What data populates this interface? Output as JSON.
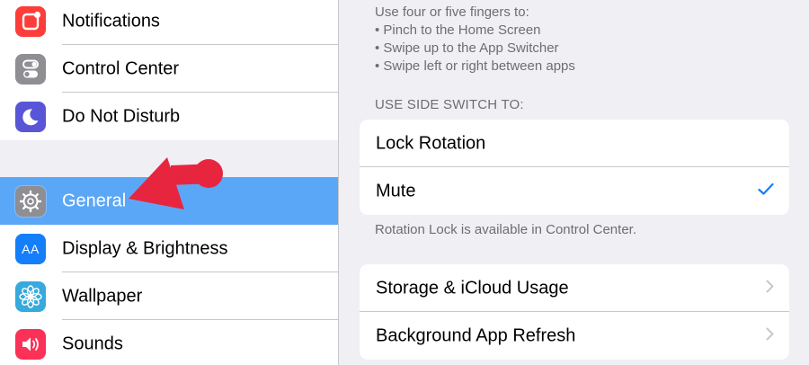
{
  "sidebar": {
    "items": [
      {
        "label": "Notifications",
        "icon": "notifications-icon",
        "icon_color": "#fc3d39"
      },
      {
        "label": "Control Center",
        "icon": "control-center-icon",
        "icon_color": "#8e8e93"
      },
      {
        "label": "Do Not Disturb",
        "icon": "moon-icon",
        "icon_color": "#5856d6"
      },
      {
        "label": "General",
        "icon": "gear-icon",
        "icon_color": "#8e8e93",
        "selected": true
      },
      {
        "label": "Display & Brightness",
        "icon": "display-brightness-icon",
        "icon_color": "#147efb"
      },
      {
        "label": "Wallpaper",
        "icon": "wallpaper-icon",
        "icon_color": "#36aadc"
      },
      {
        "label": "Sounds",
        "icon": "speaker-icon",
        "icon_color": "#fc3158"
      }
    ],
    "display_icon_text": "AA",
    "selection_color": "#5ba7f7"
  },
  "detail": {
    "gestures_lines": [
      "Use four or five fingers to:",
      "• Pinch to the Home Screen",
      "• Swipe up to the App Switcher",
      "• Swipe left or right between apps"
    ],
    "side_switch_header": "USE SIDE SWITCH TO:",
    "side_switch_options": [
      {
        "label": "Lock Rotation",
        "checked": false
      },
      {
        "label": "Mute",
        "checked": true
      }
    ],
    "side_switch_footer": "Rotation Lock is available in Control Center.",
    "more_items": [
      {
        "label": "Storage & iCloud Usage"
      },
      {
        "label": "Background App Refresh"
      }
    ],
    "accent_color": "#147efb"
  },
  "annotation": {
    "arrow_color": "#e8253f",
    "points_to": "General"
  }
}
